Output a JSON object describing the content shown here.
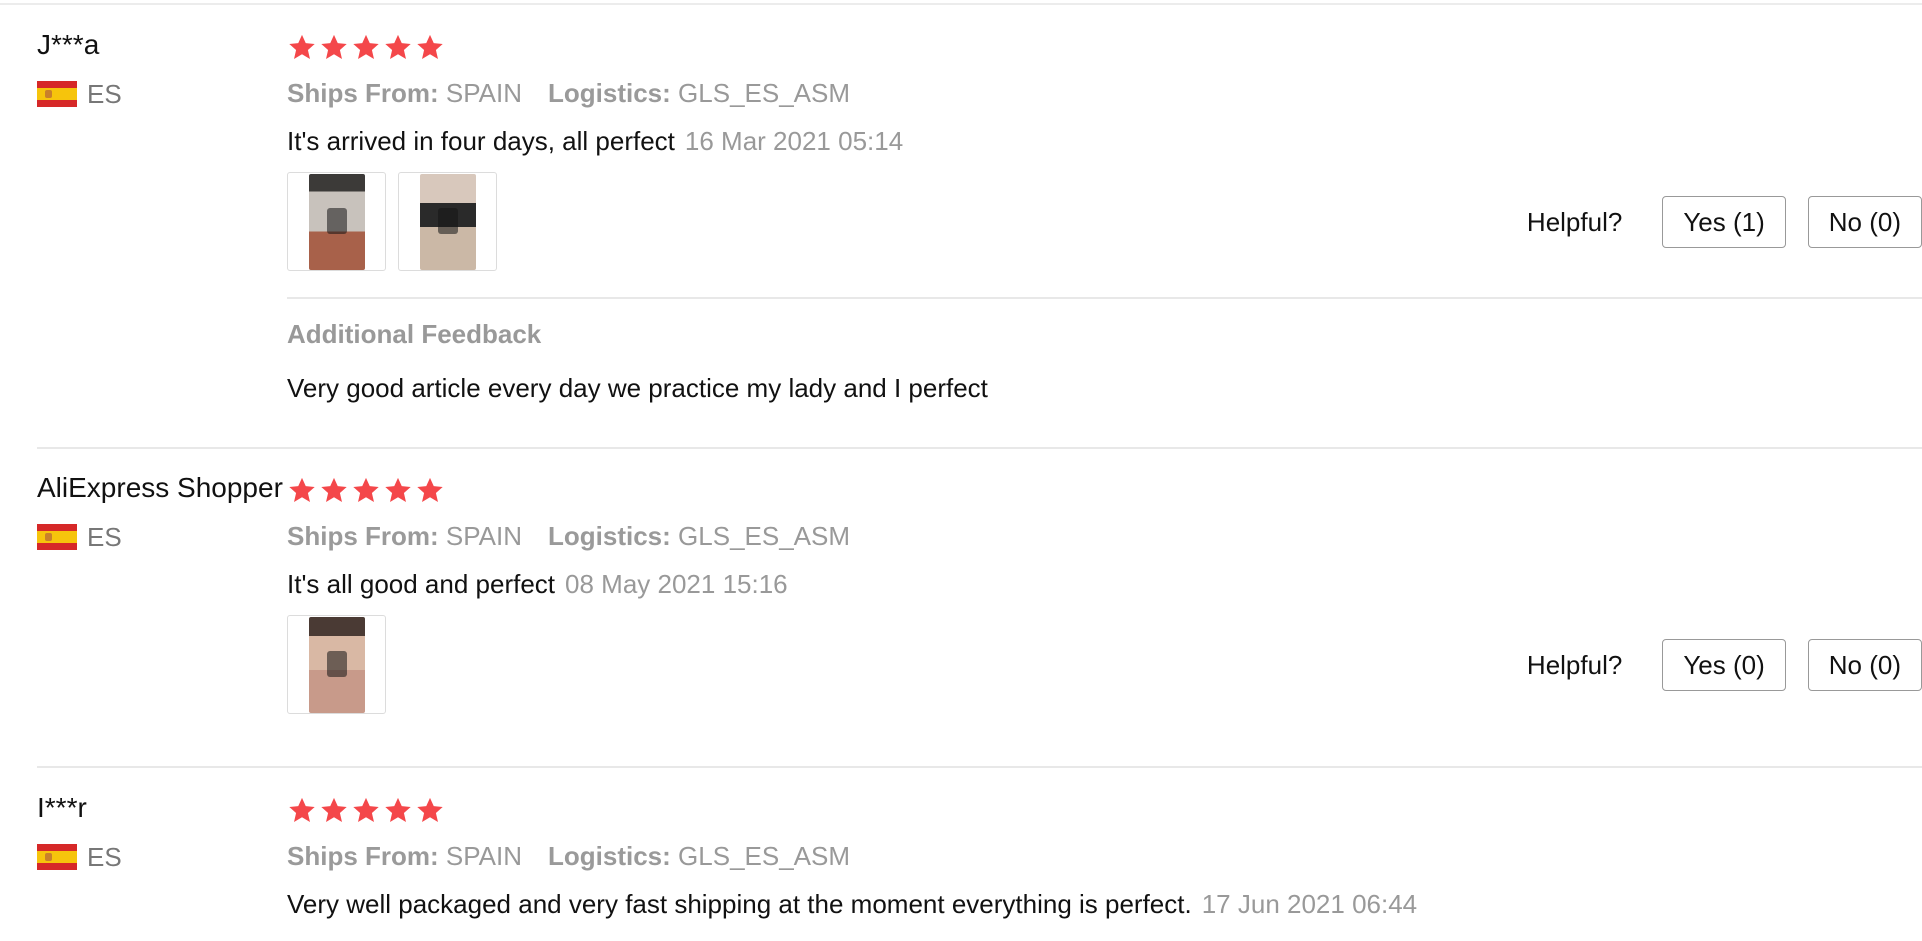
{
  "reviews": [
    {
      "username": "J***a",
      "country": "ES",
      "rating": 5,
      "ships_from_label": "Ships From:",
      "ships_from": "SPAIN",
      "logistics_label": "Logistics:",
      "logistics": "GLS_ES_ASM",
      "text": "It's arrived in four days, all perfect",
      "date": "16 Mar 2021 05:14",
      "photos": 2,
      "helpful_label": "Helpful?",
      "yes_label": "Yes (1)",
      "no_label": "No (0)",
      "additional_title": "Additional Feedback",
      "additional_text": "Very good article every day we practice my lady and I perfect"
    },
    {
      "username": "AliExpress Shopper",
      "country": "ES",
      "rating": 5,
      "ships_from_label": "Ships From:",
      "ships_from": "SPAIN",
      "logistics_label": "Logistics:",
      "logistics": "GLS_ES_ASM",
      "text": "It's all good and perfect",
      "date": "08 May 2021 15:16",
      "photos": 1,
      "helpful_label": "Helpful?",
      "yes_label": "Yes (0)",
      "no_label": "No (0)"
    },
    {
      "username": "I***r",
      "country": "ES",
      "rating": 5,
      "ships_from_label": "Ships From:",
      "ships_from": "SPAIN",
      "logistics_label": "Logistics:",
      "logistics": "GLS_ES_ASM",
      "text": "Very well packaged and very fast shipping at the moment everything is perfect.",
      "date": "17 Jun 2021 06:44"
    }
  ],
  "colors": {
    "star": "#f4474a",
    "muted": "#999999",
    "flag_red": "#d62828",
    "flag_yellow": "#f6c40c"
  },
  "icons": {
    "star": "star-icon",
    "flag": "spain-flag-icon"
  }
}
